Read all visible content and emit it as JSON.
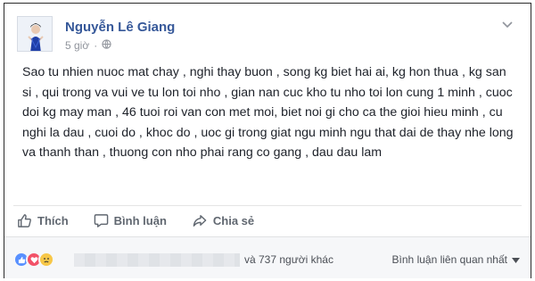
{
  "post": {
    "author": "Nguyễn Lê Giang",
    "time": "5 giờ",
    "privacy_icon": "globe-icon",
    "options_icon": "chevron-down-icon",
    "text": "Sao tu nhien nuoc mat chay , nghi thay buon , song kg biet hai ai, kg hon thua , kg san si , qui trong va vui ve tu lon toi nho , gian nan cuc kho tu nho toi lon cung 1 minh , cuoc doi kg may man , 46 tuoi roi van con met moi, biet noi gi cho ca the gioi hieu minh , cu nghi la dau , cuoi do , khoc do , uoc gi trong giat ngu minh ngu that dai de thay nhe long va thanh than , thuong con nho phai rang co gang , dau dau lam"
  },
  "actions": {
    "like": "Thích",
    "comment": "Bình luận",
    "share": "Chia sẻ"
  },
  "footer": {
    "reactions": [
      "like",
      "love",
      "sad"
    ],
    "others": "và 737 người khác",
    "sort_label": "Bình luận liên quan nhất"
  },
  "colors": {
    "author": "#365899",
    "like_reaction": "#5890ff",
    "love_reaction": "#f25268",
    "sad_reaction": "#f7c748"
  }
}
